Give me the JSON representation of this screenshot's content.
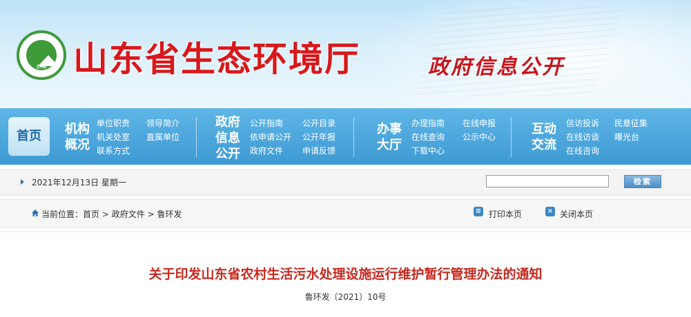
{
  "header": {
    "logo_text": "ZHB",
    "site_name": "山东省生态环境厅",
    "slogan": "政府信息公开"
  },
  "nav": {
    "home": "首页",
    "groups": [
      {
        "title": [
          "机构",
          "概况"
        ],
        "links": [
          "单位职责",
          "领导简介",
          "机关处室",
          "直属单位",
          "联系方式"
        ]
      },
      {
        "title": [
          "政府",
          "信息",
          "公开"
        ],
        "links": [
          "公开指南",
          "公开目录",
          "依申请公开",
          "公开年报",
          "政府文件",
          "申请反馈"
        ]
      },
      {
        "title": [
          "办事",
          "大厅"
        ],
        "links": [
          "办理指南",
          "在线申报",
          "在线查询",
          "公示中心",
          "下载中心"
        ]
      },
      {
        "title": [
          "互动",
          "交流"
        ],
        "links": [
          "信访投诉",
          "民意征集",
          "在线访谈",
          "曝光台",
          "在线咨询"
        ]
      }
    ]
  },
  "datebar": {
    "date": "2021年12月13日 星期一",
    "search_placeholder": "",
    "search_button": "检索"
  },
  "breadcrumb": {
    "prefix": "当前位置：",
    "items": [
      "首页",
      "政府文件",
      "鲁环发"
    ],
    "separator": ">"
  },
  "tools": {
    "print": "打印本页",
    "close": "关闭本页"
  },
  "article": {
    "title": "关于印发山东省农村生活污水处理设施运行维护暂行管理办法的通知",
    "doc_number": "鲁环发〔2021〕10号"
  },
  "colors": {
    "brand_red": "#d7191d",
    "nav_blue": "#3e9ad3",
    "title_red": "#c8281e"
  }
}
